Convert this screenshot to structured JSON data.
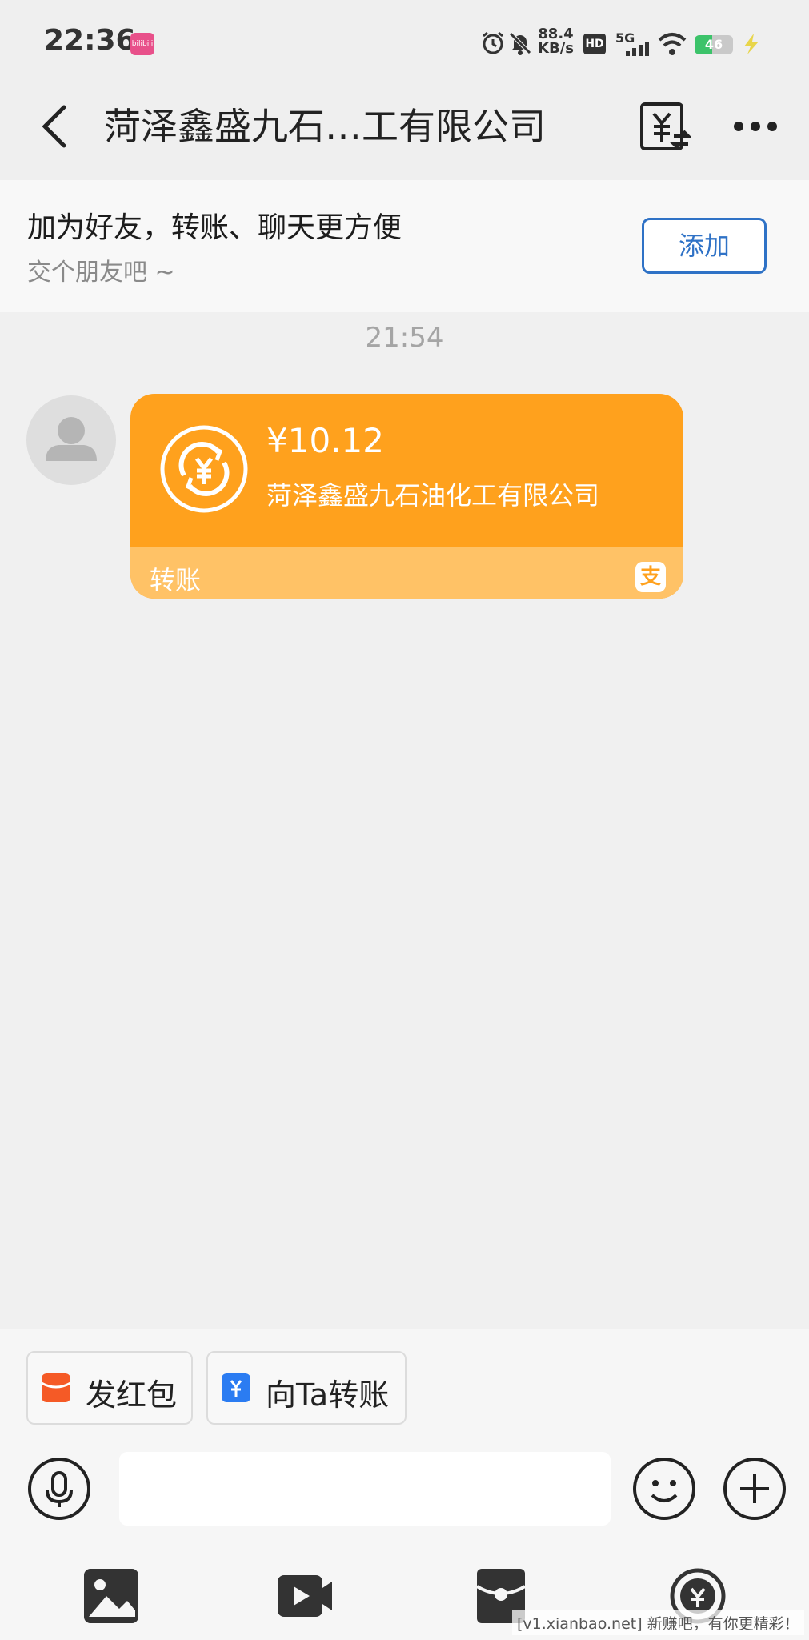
{
  "status_bar": {
    "time": "22:36",
    "app_badge": "bilibili",
    "net_speed_value": "88.4",
    "net_speed_unit": "KB/s",
    "hd": "HD",
    "network": "5G",
    "battery": "46",
    "battery_level": 0.46,
    "icons": [
      "alarm-icon",
      "mute-bell-icon",
      "signal-icon",
      "wifi-icon",
      "charging-icon"
    ]
  },
  "header": {
    "title": "菏泽鑫盛九石…工有限公司",
    "icons": [
      "back-icon",
      "transfer-yuan-icon",
      "more-icon"
    ]
  },
  "friend_banner": {
    "title": "加为好友，转账、聊天更方便",
    "subtitle": "交个朋友吧 ~",
    "add_label": "添加"
  },
  "chat": {
    "timestamp": "21:54",
    "transfer": {
      "amount": "¥10.12",
      "payee": "菏泽鑫盛九石油化工有限公司",
      "label": "转账",
      "accent": "#ffa11d",
      "provider_icon": "支"
    }
  },
  "quick_actions": {
    "red_packet": "发红包",
    "transfer_to": "向Ta转账"
  },
  "input": {
    "placeholder": ""
  },
  "toolbar": [
    "image-icon",
    "video-icon",
    "red-packet-icon",
    "transfer-icon"
  ],
  "watermark": "[v1.xianbao.net] 新赚吧，有你更精彩！"
}
